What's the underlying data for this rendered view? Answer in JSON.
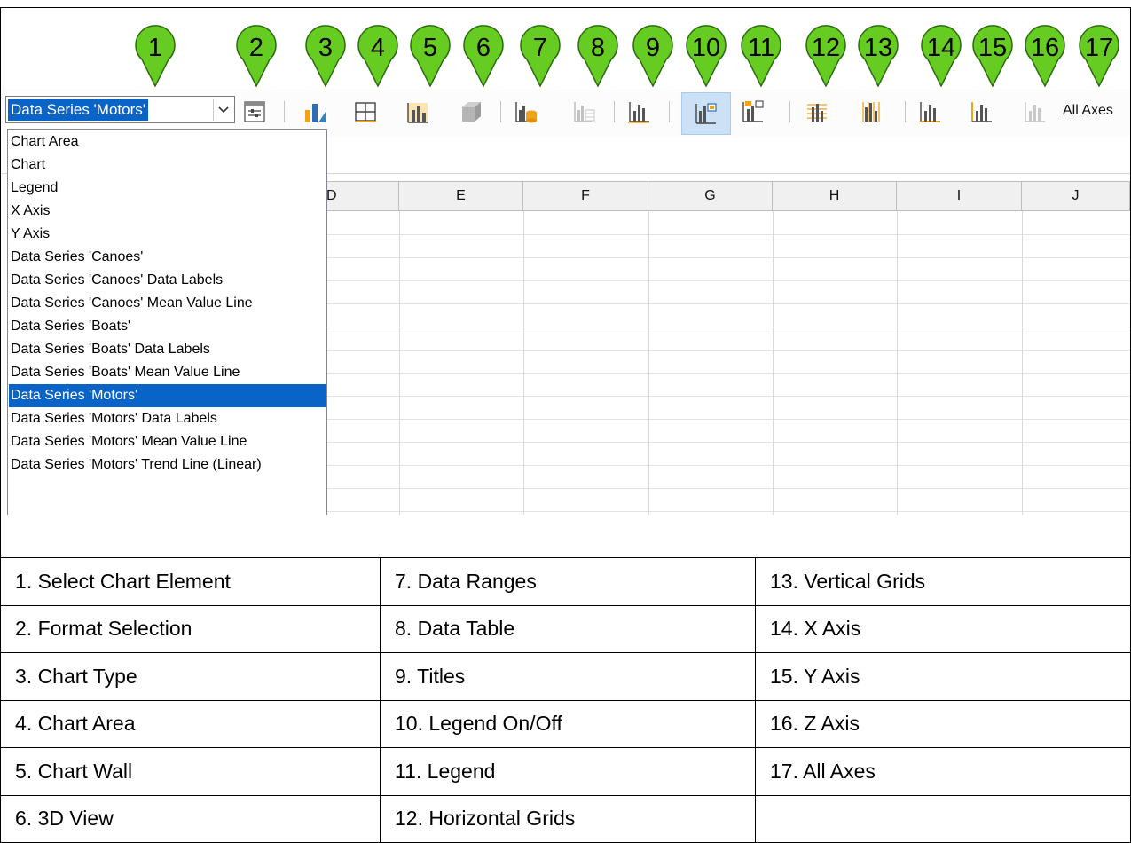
{
  "callouts": [
    "1",
    "2",
    "3",
    "4",
    "5",
    "6",
    "7",
    "8",
    "9",
    "10",
    "11",
    "12",
    "13",
    "14",
    "15",
    "16",
    "17"
  ],
  "toolbar": {
    "selected_element": "Data Series 'Motors'",
    "all_axes_label": "All Axes",
    "icons": [
      "select-chart-element",
      "format-selection",
      "chart-type",
      "chart-area",
      "chart-wall",
      "3d-view",
      "data-ranges",
      "data-table",
      "titles",
      "legend-on-off",
      "legend",
      "horizontal-grids",
      "vertical-grids",
      "x-axis",
      "y-axis",
      "z-axis",
      "all-axes"
    ]
  },
  "columns": [
    "D",
    "E",
    "F",
    "G",
    "H",
    "I",
    "J"
  ],
  "dropdown": {
    "items": [
      "Chart Area",
      "Chart",
      "Legend",
      "X Axis",
      "Y Axis",
      "Data Series 'Canoes'",
      "Data Series 'Canoes' Data Labels",
      "Data Series 'Canoes' Mean Value Line",
      "Data Series 'Boats'",
      "Data Series 'Boats' Data Labels",
      "Data Series 'Boats' Mean Value Line",
      "Data Series 'Motors'",
      "Data Series 'Motors' Data Labels",
      "Data Series 'Motors' Mean Value Line",
      "Data Series 'Motors'  Trend Line (Linear)"
    ],
    "selected_index": 11
  },
  "legend_table": {
    "rows": [
      [
        "1. Select Chart Element",
        "7. Data Ranges",
        "13. Vertical Grids"
      ],
      [
        "2. Format Selection",
        "8. Data Table",
        "14. X Axis"
      ],
      [
        "3. Chart Type",
        "9. Titles",
        "15. Y Axis"
      ],
      [
        "4. Chart Area",
        "10. Legend On/Off",
        "16. Z Axis"
      ],
      [
        "5. Chart Wall",
        "11. Legend",
        "17. All Axes"
      ],
      [
        "6. 3D View",
        "12. Horizontal Grids",
        ""
      ]
    ]
  },
  "colors": {
    "callout_fill": "#66cc22",
    "selection": "#0a64c8",
    "active_button": "#cce1f5"
  }
}
